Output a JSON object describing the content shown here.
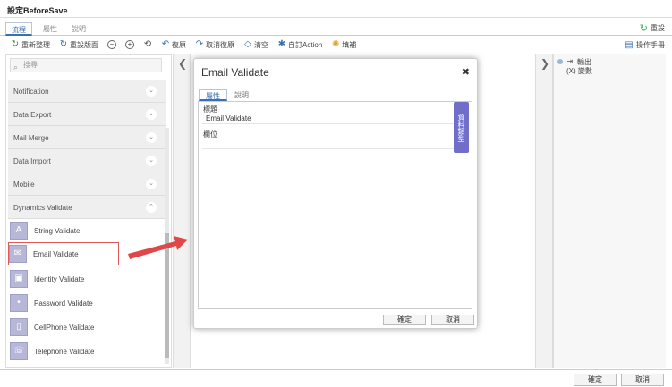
{
  "window": {
    "title": "設定BeforeSave"
  },
  "tabs": [
    {
      "label": "流程"
    },
    {
      "label": "屬性"
    },
    {
      "label": "說明"
    }
  ],
  "reset_label": "重設",
  "toolbar": {
    "rearrange": "重新整理",
    "reorder_layout": "重設版面",
    "undo": "復原",
    "cancel_undo": "取消復原",
    "clear": "清空",
    "custom_action": "自訂Action",
    "fill": "填補",
    "manual": "操作手冊"
  },
  "search": {
    "placeholder": "搜尋"
  },
  "categories": [
    {
      "label": "Notification"
    },
    {
      "label": "Data Export"
    },
    {
      "label": "Mail Merge"
    },
    {
      "label": "Data Import"
    },
    {
      "label": "Mobile"
    },
    {
      "label": "Dynamics Validate"
    }
  ],
  "items": [
    {
      "label": "String Validate"
    },
    {
      "label": "Email Validate"
    },
    {
      "label": "Identity Validate"
    },
    {
      "label": "Password Validate"
    },
    {
      "label": "CellPhone Validate"
    },
    {
      "label": "Telephone Validate"
    }
  ],
  "right_panel": {
    "output": "輸出",
    "variable": "(X) 變數"
  },
  "dialog": {
    "title": "Email Validate",
    "tabs": [
      {
        "label": "屬性"
      },
      {
        "label": "說明"
      }
    ],
    "fields": [
      {
        "label": "標題",
        "value": "Email Validate"
      },
      {
        "label": "欄位",
        "value": ""
      }
    ],
    "side_tab": "資料類型",
    "ok": "確定",
    "cancel": "取消"
  },
  "footer": {
    "ok": "確定",
    "cancel": "取消"
  },
  "colors": {
    "accent": "#3a6fb0",
    "highlight": "#e05a5a",
    "side_tab": "#6f6fcb"
  }
}
